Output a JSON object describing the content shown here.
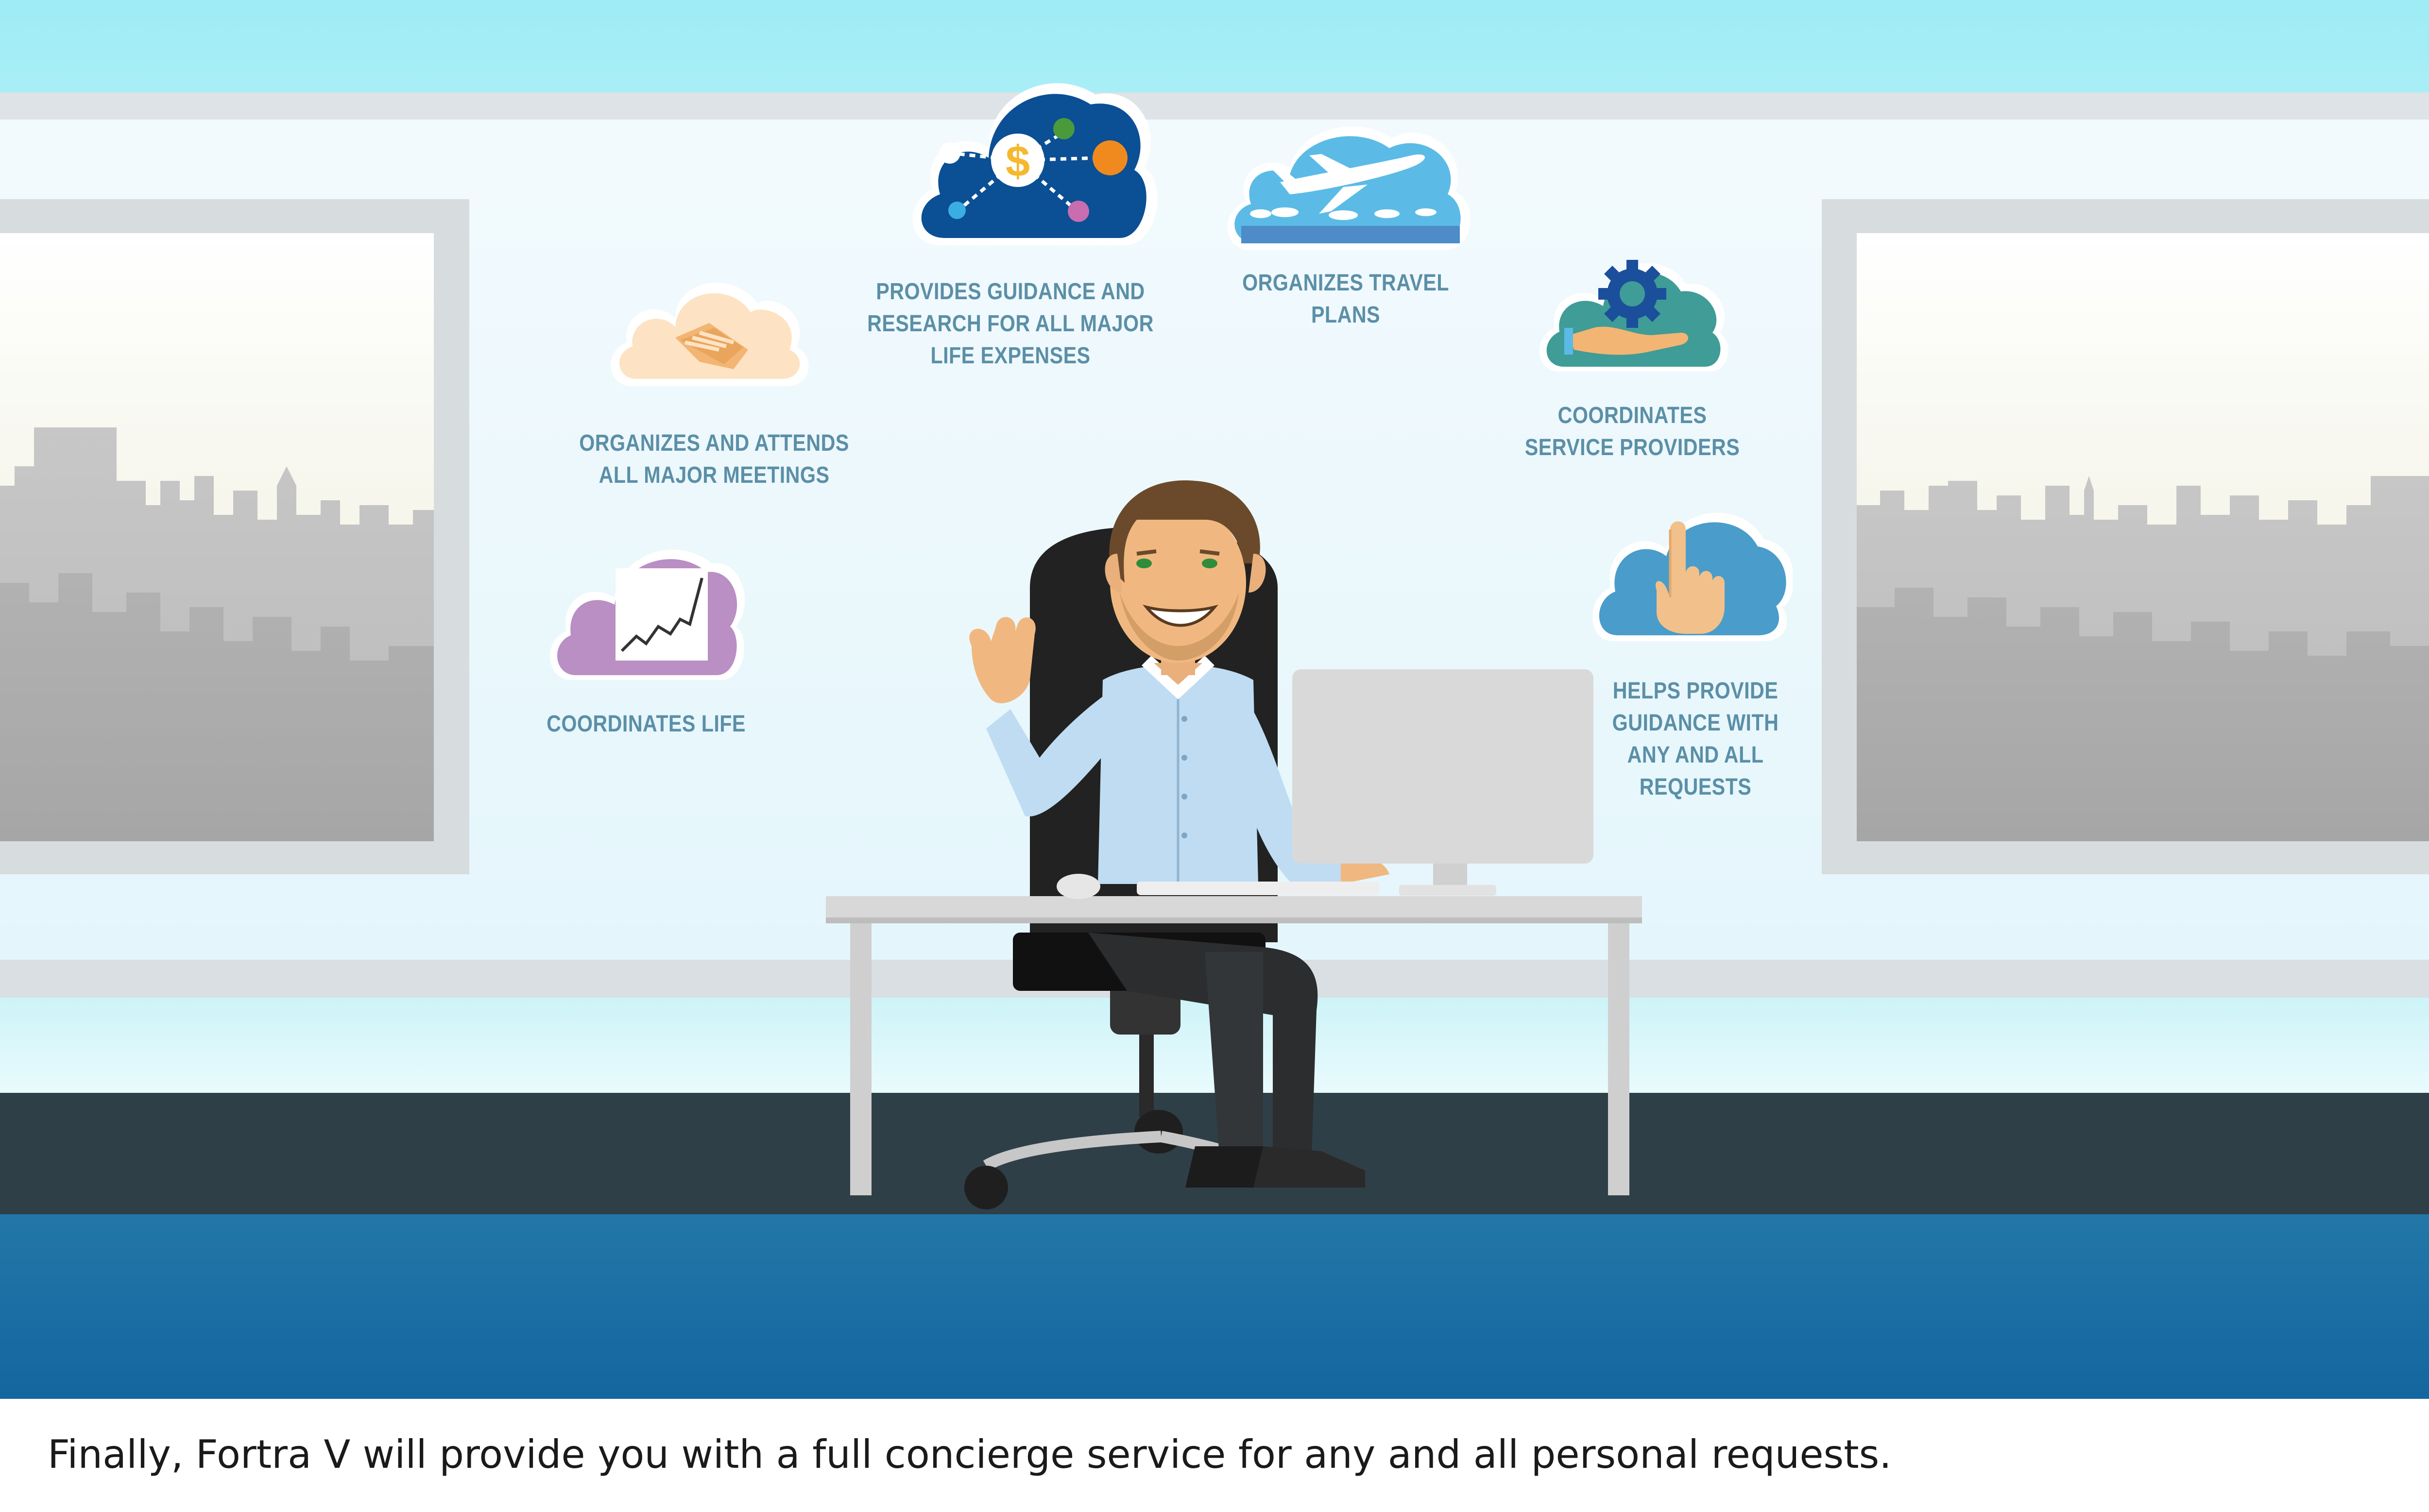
{
  "scene": {
    "services": [
      {
        "id": "meetings",
        "label": "ORGANIZES AND ATTENDS ALL MAJOR MEETINGS",
        "icon": "handshake-icon",
        "color": "#fbe1c0"
      },
      {
        "id": "expenses",
        "label": "PROVIDES GUIDANCE AND RESEARCH FOR ALL MAJOR LIFE EXPENSES",
        "icon": "dollar-network-icon",
        "color": "#0b4f94"
      },
      {
        "id": "travel",
        "label": "ORGANIZES TRAVEL PLANS",
        "icon": "airplane-icon",
        "color": "#5bbbe6"
      },
      {
        "id": "providers",
        "label": "COORDINATES SERVICE PROVIDERS",
        "icon": "gear-hand-icon",
        "color": "#3f9c96"
      },
      {
        "id": "life",
        "label": "COORDINATES LIFE",
        "icon": "rising-chart-icon",
        "color": "#b98fc4"
      },
      {
        "id": "requests",
        "label": "HELPS PROVIDE GUIDANCE WITH ANY AND ALL REQUESTS",
        "icon": "pointing-hand-icon",
        "color": "#4a9cca"
      }
    ]
  },
  "caption": "Finally, Fortra V will provide you with a full concierge service for any and all personal requests."
}
